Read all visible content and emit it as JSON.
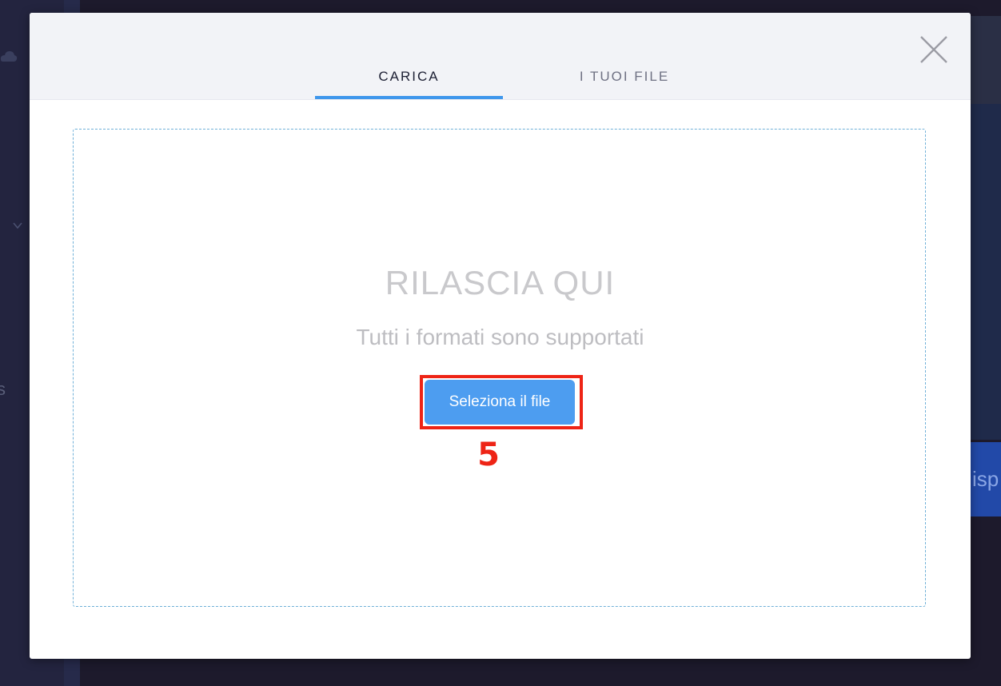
{
  "background": {
    "left_fragment_text": "s",
    "right_button_fragment": "isp"
  },
  "modal": {
    "tabs": [
      {
        "label": "CARICA",
        "active": true
      },
      {
        "label": "I TUOI FILE",
        "active": false
      }
    ],
    "close_icon": "close-icon",
    "dropzone": {
      "title": "RILASCIA QUI",
      "subtitle": "Tutti i formati sono supportati",
      "select_button_label": "Seleziona il file"
    },
    "annotation": {
      "step_number": "5",
      "color": "#ee2416"
    }
  },
  "colors": {
    "accent": "#3f97ec",
    "button": "#4d9df0",
    "header_bg": "#f2f3f7",
    "dropzone_border": "#6fb0d8"
  }
}
